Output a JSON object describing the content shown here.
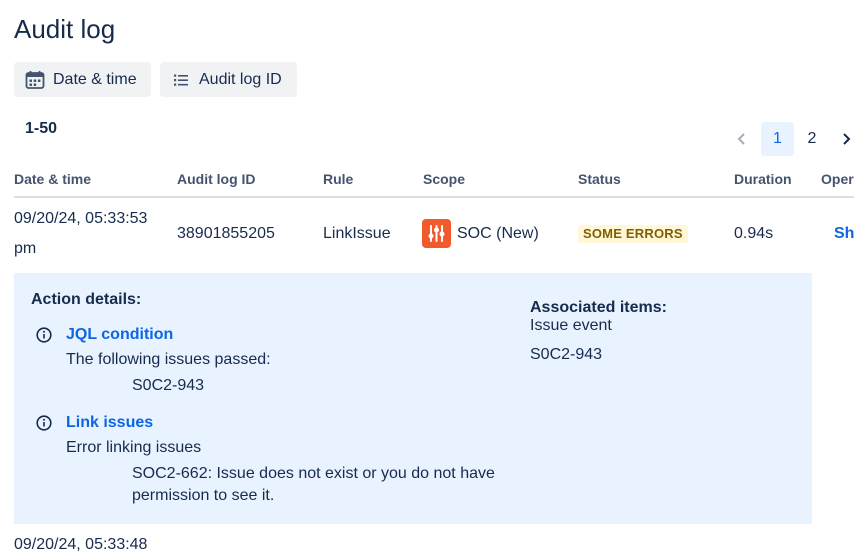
{
  "page": {
    "title": "Audit log"
  },
  "toolbar": {
    "date_time_label": "Date & time",
    "audit_id_label": "Audit log ID"
  },
  "pagination": {
    "range": "1-50",
    "pages": [
      "1",
      "2"
    ],
    "current": "1"
  },
  "table": {
    "headers": [
      "Date & time",
      "Audit log ID",
      "Rule",
      "Scope",
      "Status",
      "Duration",
      "Operations"
    ],
    "rows": [
      {
        "date_line1": "09/20/24, 05:33:53",
        "date_line2": "pm",
        "id": "38901855205",
        "rule": "LinkIssue",
        "scope": "SOC (New)",
        "status": "SOME ERRORS",
        "duration": "0.94s",
        "operations": "Show"
      }
    ],
    "next_row_date": "09/20/24, 05:33:48"
  },
  "details": {
    "action_title": "Action details:",
    "actions": [
      {
        "name": "JQL condition",
        "message": "The following issues passed:",
        "detail_lines": [
          "S0C2-943"
        ]
      },
      {
        "name": "Link issues",
        "message": "Error linking issues",
        "detail_lines": [
          "SOC2-662: Issue does not exist or you do not have",
          "permission to see it."
        ]
      }
    ],
    "associated_title": "Associated items:",
    "associated_type": "Issue event",
    "associated_link": "S0C2-943"
  },
  "colors": {
    "accent": "#0c66e4",
    "panel": "#e9f2ff",
    "badge_bg": "#fff7d6",
    "badge_text": "#7f5f01",
    "scope_icon": "#f15a2b"
  },
  "icons": {
    "date": "calendar-icon",
    "id": "list-icon",
    "info": "info-icon",
    "prev": "chevron-left-icon",
    "next": "chevron-right-icon",
    "scope": "project-icon"
  }
}
